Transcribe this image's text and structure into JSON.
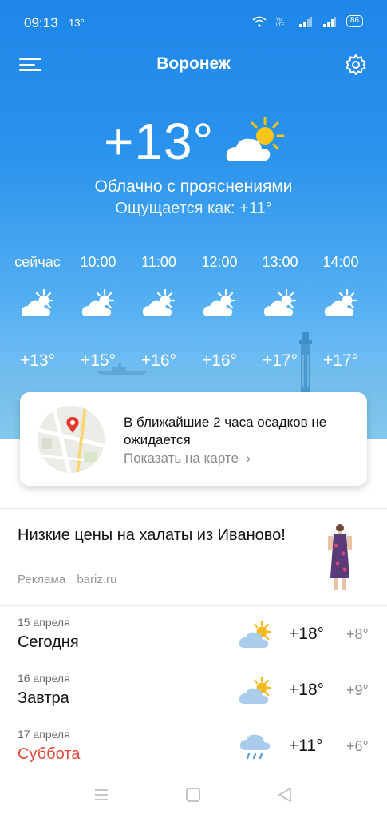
{
  "status_bar": {
    "time": "09:13",
    "temp": "13°",
    "battery": "86"
  },
  "header": {
    "city": "Воронеж"
  },
  "current": {
    "temp": "+13°",
    "condition": "Облачно с прояснениями",
    "feels_like": "Ощущается как: +11°"
  },
  "hourly": [
    {
      "time": "сейчас",
      "temp": "+13°"
    },
    {
      "time": "10:00",
      "temp": "+15°"
    },
    {
      "time": "11:00",
      "temp": "+16°"
    },
    {
      "time": "12:00",
      "temp": "+16°"
    },
    {
      "time": "13:00",
      "temp": "+17°"
    },
    {
      "time": "14:00",
      "temp": "+17°"
    }
  ],
  "precip_card": {
    "text": "В ближайшие 2 часа осадков не ожидается",
    "link": "Показать на карте"
  },
  "ad": {
    "title": "Низкие цены на халаты из Иваново!",
    "label": "Реклама",
    "domain": "bariz.ru"
  },
  "daily": [
    {
      "date": "15 апреля",
      "name": "Сегодня",
      "high": "+18°",
      "low": "+8°",
      "icon": "partly-cloudy-icon",
      "weekend": false
    },
    {
      "date": "16 апреля",
      "name": "Завтра",
      "high": "+18°",
      "low": "+9°",
      "icon": "partly-cloudy-icon",
      "weekend": false
    },
    {
      "date": "17 апреля",
      "name": "Суббота",
      "high": "+11°",
      "low": "+6°",
      "icon": "rain-icon",
      "weekend": true
    }
  ],
  "colors": {
    "sky_top": "#1e86e8",
    "sky_bottom": "#8fcdf6",
    "weekend": "#e04b3a"
  }
}
